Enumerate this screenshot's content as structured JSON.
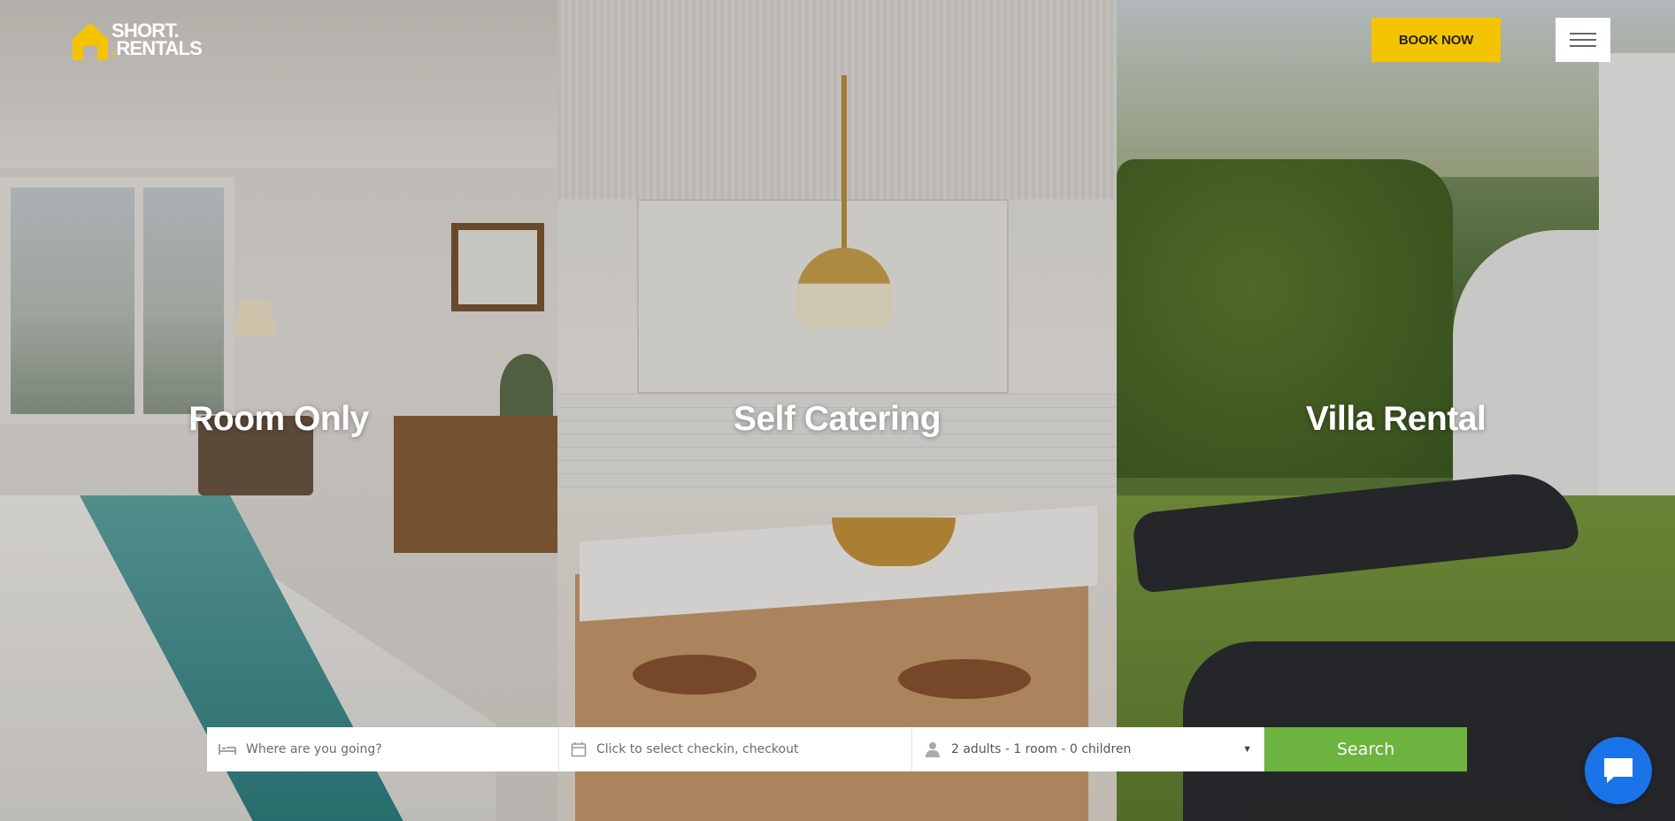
{
  "brand": {
    "logo_line1": "SHORT",
    "logo_line2": "RENTALS",
    "logo_dot": ".",
    "accent_color": "#f5c400"
  },
  "header": {
    "book_now_label": "BOOK NOW",
    "menu_icon": "hamburger-menu-icon"
  },
  "panels": [
    {
      "title": "Room Only"
    },
    {
      "title": "Self Catering"
    },
    {
      "title": "Villa Rental"
    }
  ],
  "search": {
    "destination_placeholder": "Where are you going?",
    "destination_icon": "bed-icon",
    "dates_placeholder": "Click to select checkin, checkout",
    "dates_icon": "calendar-icon",
    "guests_value": "2 adults - 1 room - 0 children",
    "guests_icon": "person-icon",
    "search_label": "Search",
    "search_color": "#6db33f"
  },
  "chat": {
    "icon": "chat-bubble-icon",
    "color": "#1a73e8"
  }
}
